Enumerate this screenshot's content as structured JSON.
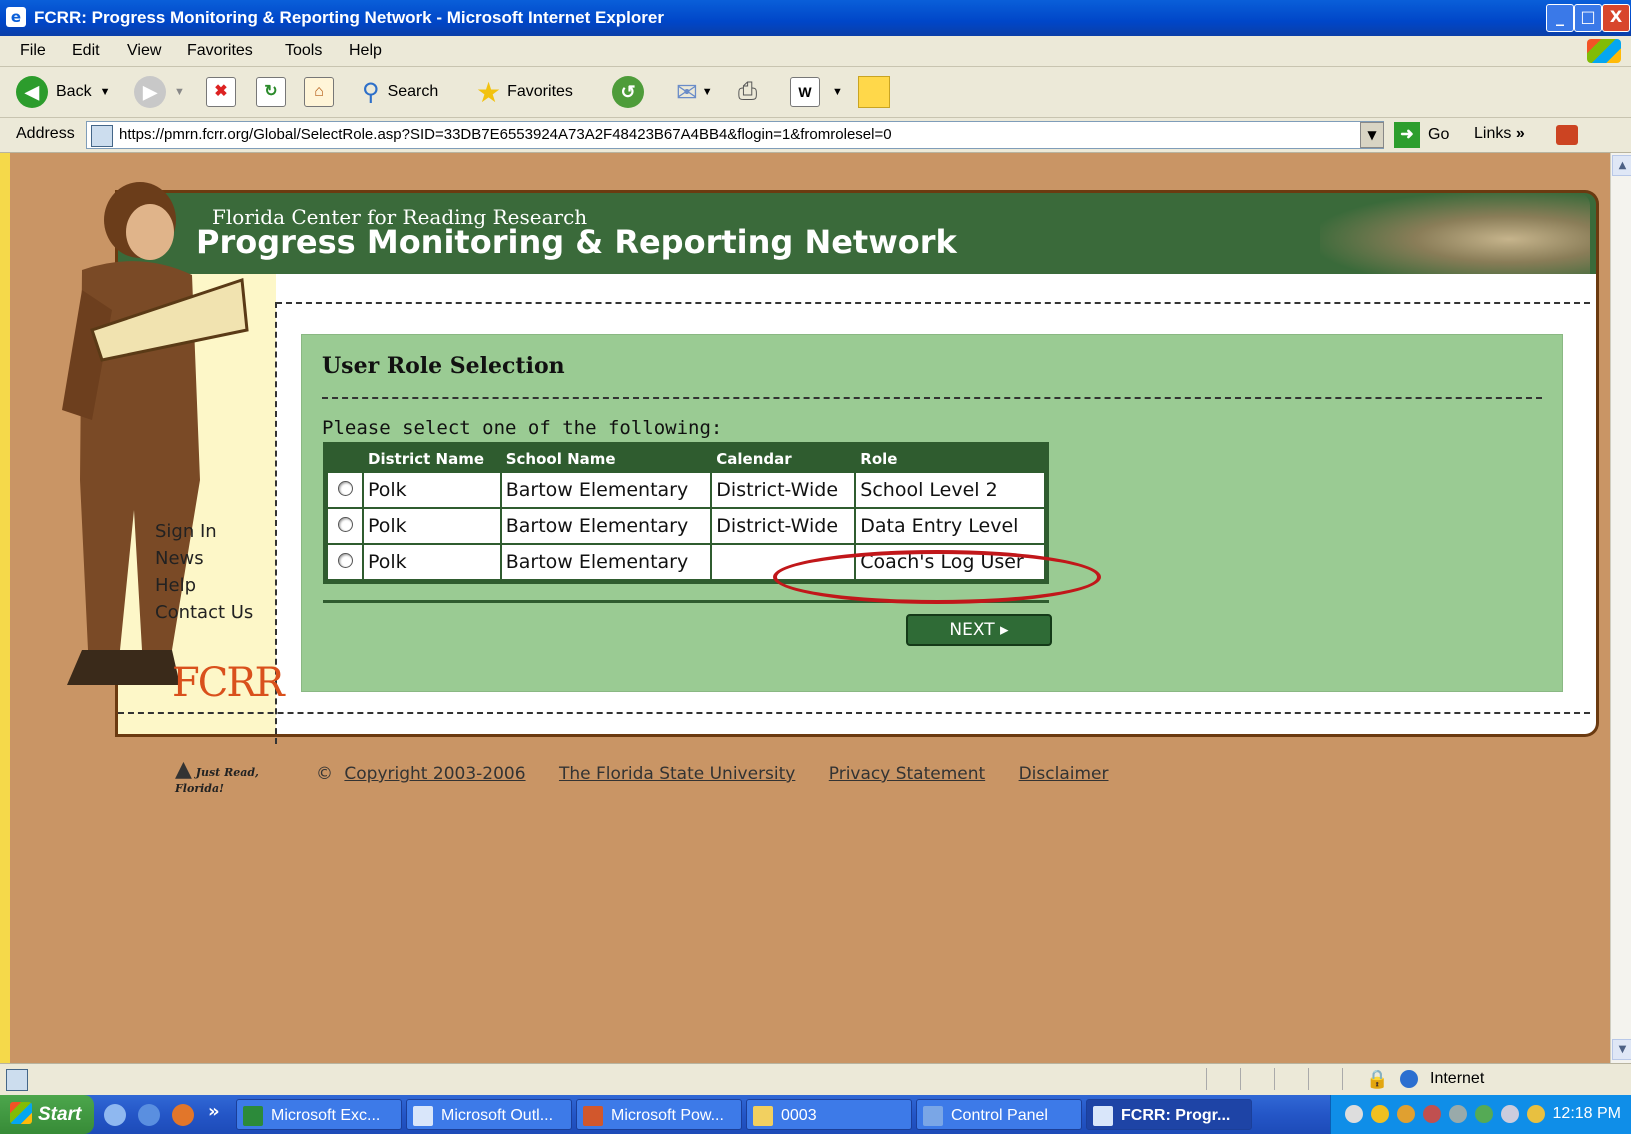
{
  "window": {
    "title": "FCRR: Progress Monitoring & Reporting Network - Microsoft Internet Explorer",
    "controls": [
      "_",
      "□",
      "X"
    ]
  },
  "menu": [
    "File",
    "Edit",
    "View",
    "Favorites",
    "Tools",
    "Help"
  ],
  "toolbar": {
    "back_label": "Back",
    "search_label": "Search",
    "favorites_label": "Favorites"
  },
  "address": {
    "label": "Address",
    "url": "https://pmrn.fcrr.org/Global/SelectRole.asp?SID=33DB7E6553924A73A2F48423B67A4BB4&flogin=1&fromrolesel=0",
    "go_label": "Go",
    "links_label": "Links"
  },
  "site": {
    "org": "Florida Center for Reading Research",
    "title": "Progress Monitoring & Reporting Network",
    "nav": [
      "Sign In",
      "News",
      "Help",
      "Contact Us"
    ],
    "logo_text": "FCRR",
    "jrf_text": "Just Read, Florida!"
  },
  "panel": {
    "heading": "User Role Selection",
    "prompt": "Please select one of the following:",
    "columns": [
      "District Name",
      "School Name",
      "Calendar",
      "Role"
    ],
    "rows": [
      {
        "district": "Polk",
        "school": "Bartow Elementary",
        "calendar": "District-Wide",
        "role": "School Level 2"
      },
      {
        "district": "Polk",
        "school": "Bartow Elementary",
        "calendar": "District-Wide",
        "role": "Data Entry Level"
      },
      {
        "district": "Polk",
        "school": "Bartow Elementary",
        "calendar": "",
        "role": "Coach's Log User"
      }
    ],
    "next_label": "NEXT ▸",
    "highlight_color": "#c1171a"
  },
  "footer": {
    "copyright_symbol": "©",
    "copyright": "Copyright 2003-2006",
    "university": "The Florida State University",
    "privacy": "Privacy Statement",
    "disclaimer": "Disclaimer"
  },
  "statusbar": {
    "zone": "Internet"
  },
  "taskbar": {
    "start_label": "Start",
    "tasks": [
      "Microsoft Exc...",
      "Microsoft Outl...",
      "Microsoft Pow...",
      "0003",
      "Control Panel",
      "FCRR: Progr..."
    ],
    "clock": "12:18 PM"
  },
  "colors": {
    "banner_green": "#3a6a3a",
    "panel_green": "#9acb93",
    "page_background": "#c99565",
    "table_header": "#2f5c2f"
  }
}
